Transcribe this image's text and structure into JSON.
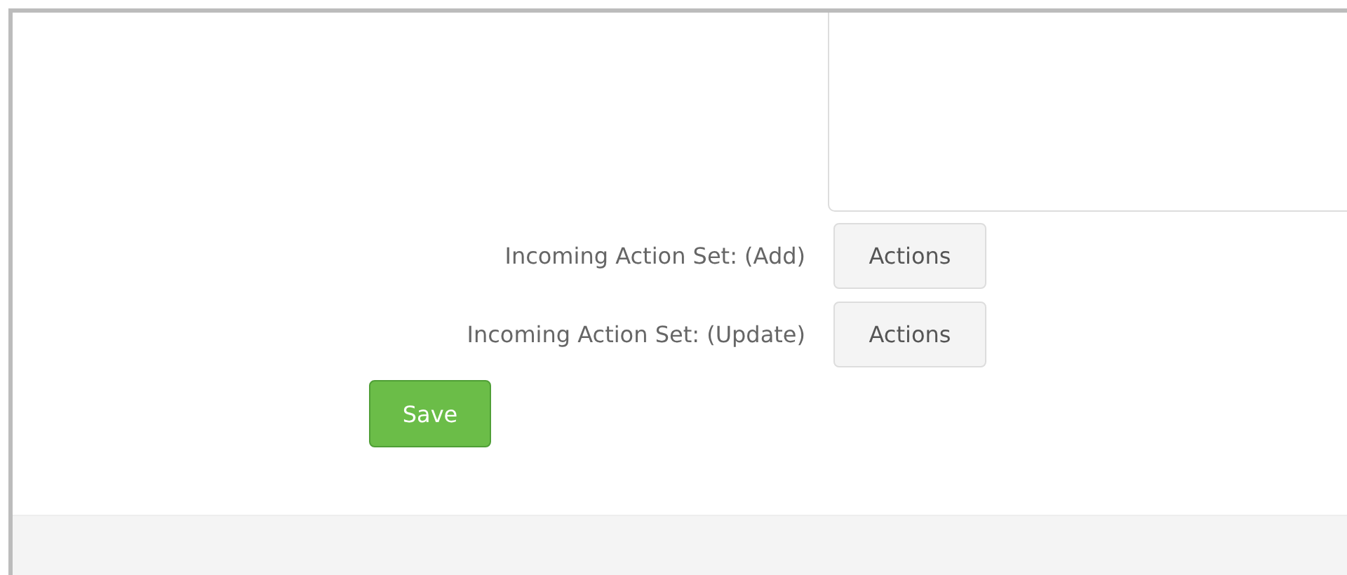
{
  "action_sets": [
    {
      "label": "Incoming Action Set: (Add)",
      "button": "Actions"
    },
    {
      "label": "Incoming Action Set: (Update)",
      "button": "Actions"
    }
  ],
  "save_button": "Save"
}
